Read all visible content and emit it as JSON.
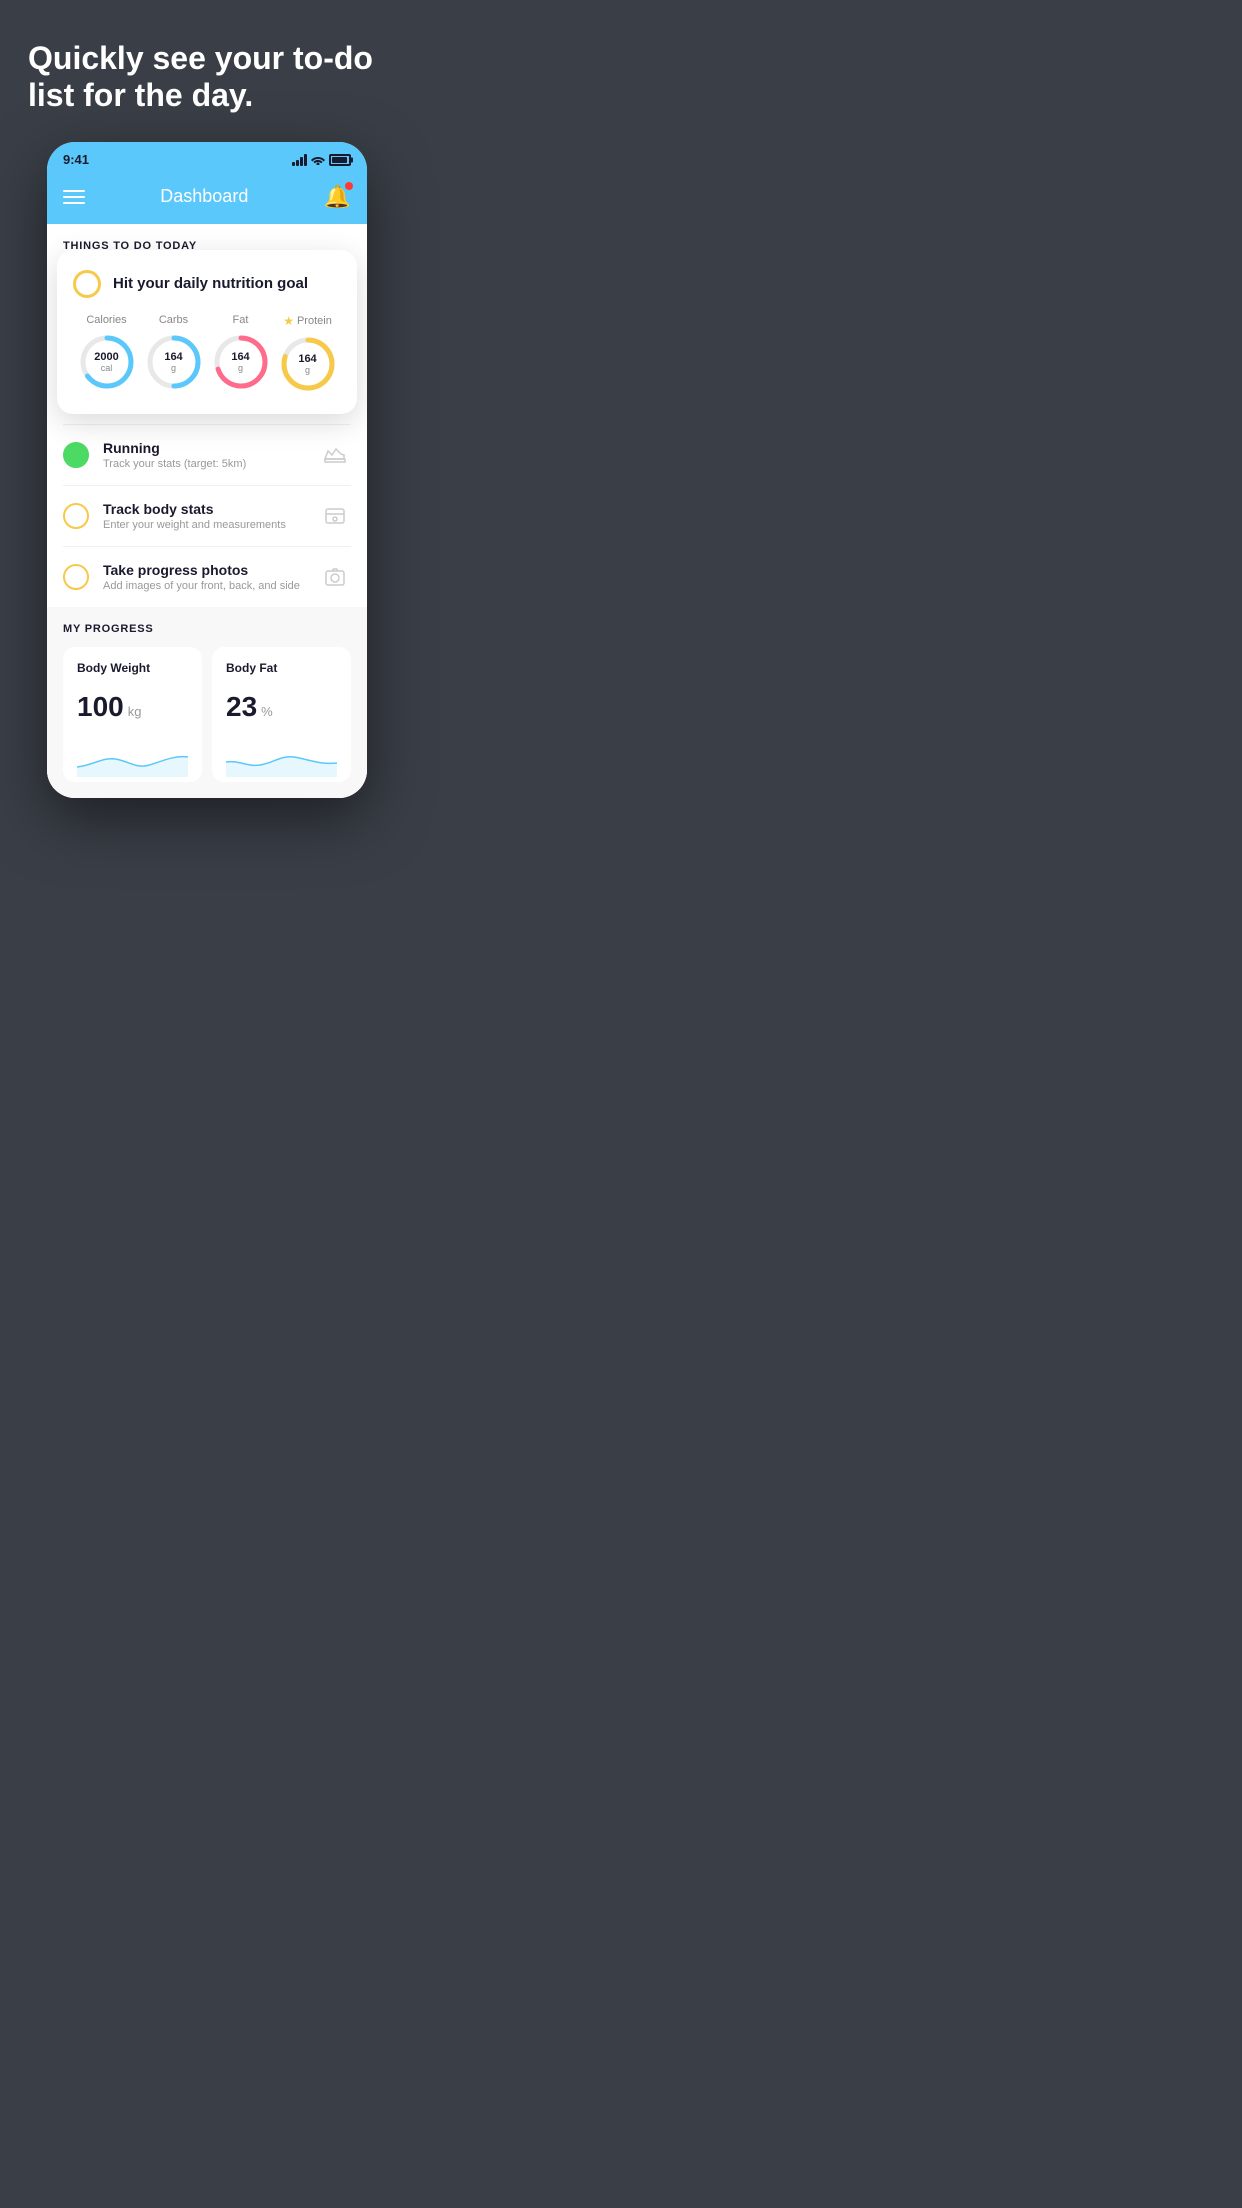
{
  "page": {
    "background": "#3a3f47",
    "headline": "Quickly see your to-do list for the day."
  },
  "statusBar": {
    "time": "9:41"
  },
  "header": {
    "title": "Dashboard"
  },
  "thingsToDo": {
    "sectionTitle": "THINGS TO DO TODAY",
    "nutritionCard": {
      "circleColor": "#f7c948",
      "title": "Hit your daily nutrition goal",
      "stats": [
        {
          "label": "Calories",
          "value": "2000",
          "unit": "cal",
          "color": "#5ac8fa",
          "progress": 0.65
        },
        {
          "label": "Carbs",
          "value": "164",
          "unit": "g",
          "color": "#5ac8fa",
          "progress": 0.5
        },
        {
          "label": "Fat",
          "value": "164",
          "unit": "g",
          "color": "#ff6b8a",
          "progress": 0.7
        },
        {
          "label": "Protein",
          "value": "164",
          "unit": "g",
          "color": "#f7c948",
          "progress": 0.8,
          "starred": true
        }
      ]
    },
    "items": [
      {
        "id": "running",
        "title": "Running",
        "subtitle": "Track your stats (target: 5km)",
        "circleType": "green-filled",
        "icon": "shoe-icon"
      },
      {
        "id": "track-body",
        "title": "Track body stats",
        "subtitle": "Enter your weight and measurements",
        "circleType": "yellow",
        "icon": "scale-icon"
      },
      {
        "id": "progress-photos",
        "title": "Take progress photos",
        "subtitle": "Add images of your front, back, and side",
        "circleType": "yellow",
        "icon": "photo-icon"
      }
    ]
  },
  "myProgress": {
    "sectionTitle": "MY PROGRESS",
    "cards": [
      {
        "title": "Body Weight",
        "value": "100",
        "unit": "kg"
      },
      {
        "title": "Body Fat",
        "value": "23",
        "unit": "%"
      }
    ]
  }
}
